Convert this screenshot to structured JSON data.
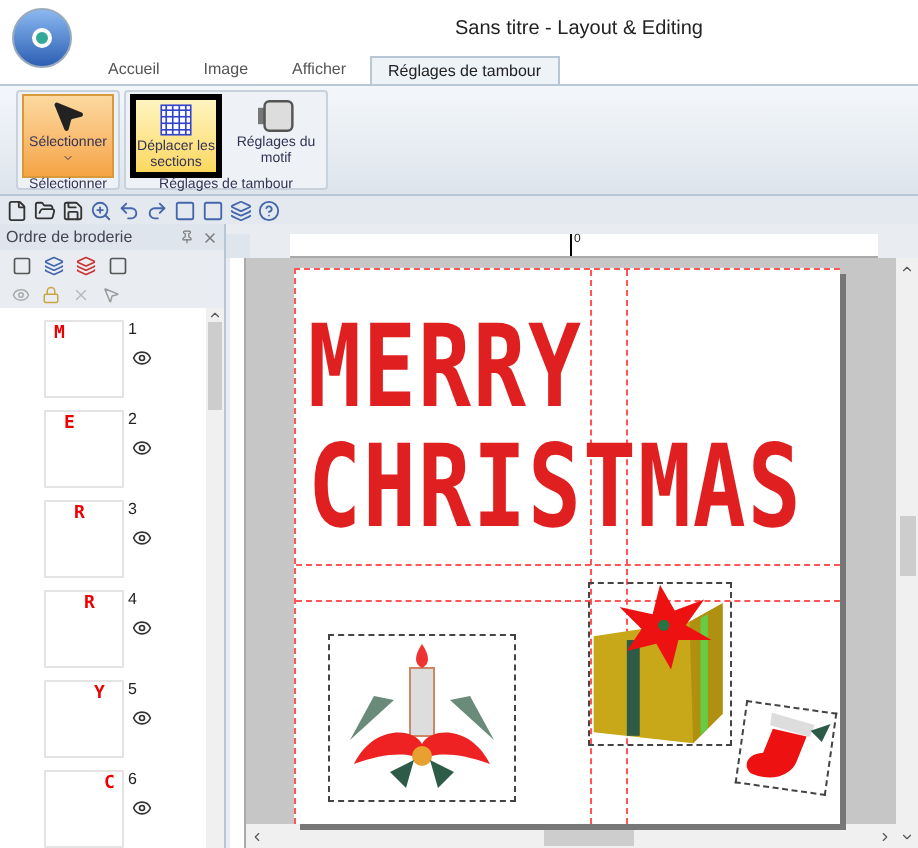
{
  "window": {
    "title": "Sans titre - Layout & Editing"
  },
  "tabs": [
    {
      "label": "Accueil",
      "selected": false
    },
    {
      "label": "Image",
      "selected": false
    },
    {
      "label": "Afficher",
      "selected": false
    },
    {
      "label": "Réglages de tambour",
      "selected": true
    }
  ],
  "ribbon": {
    "groups": [
      {
        "label": "Sélectionner",
        "buttons": [
          {
            "label": "Sélectionner",
            "kind": "arrow",
            "selected": true,
            "focused": false,
            "dropdown": true
          }
        ]
      },
      {
        "label": "Réglages de tambour",
        "buttons": [
          {
            "label": "Déplacer les sections",
            "kind": "grid",
            "selected": false,
            "focused": true,
            "dropdown": false
          },
          {
            "label": "Réglages du motif",
            "kind": "hoop",
            "selected": false,
            "focused": false,
            "dropdown": false
          }
        ]
      }
    ]
  },
  "panel": {
    "title": "Ordre de broderie",
    "items": [
      {
        "letter": "M",
        "number": "1",
        "visible": true
      },
      {
        "letter": "E",
        "number": "2",
        "visible": true
      },
      {
        "letter": "R",
        "number": "3",
        "visible": true
      },
      {
        "letter": "R",
        "number": "4",
        "visible": true
      },
      {
        "letter": "Y",
        "number": "5",
        "visible": true
      },
      {
        "letter": "C",
        "number": "6",
        "visible": true
      }
    ]
  },
  "ruler": {
    "zero": "0"
  },
  "canvas": {
    "lines": [
      "MERRY",
      "CHRISTMAS"
    ]
  }
}
